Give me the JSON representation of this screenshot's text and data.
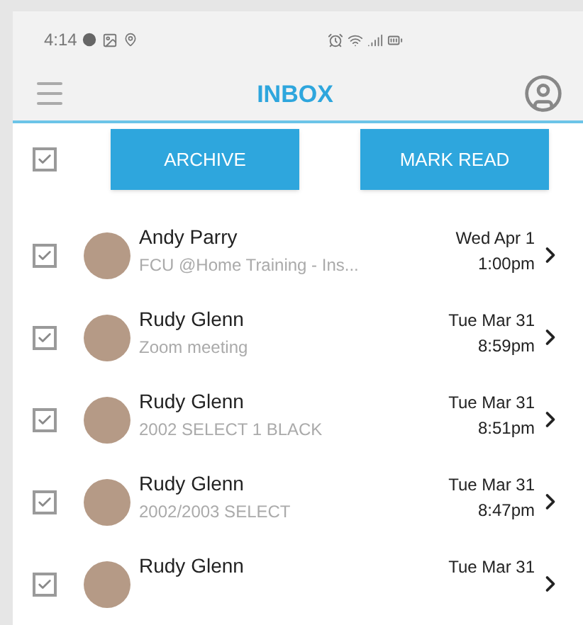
{
  "status_bar": {
    "time": "4:14"
  },
  "header": {
    "title": "INBOX"
  },
  "toolbar": {
    "select_all": {
      "checked": true
    },
    "buttons": [
      "ARCHIVE",
      "MARK READ"
    ]
  },
  "messages": [
    {
      "sender": "Andy Parry",
      "preview": "FCU @Home Training - Ins...",
      "date": "Wed Apr 1",
      "time": "1:00pm",
      "checked": true
    },
    {
      "sender": "Rudy Glenn",
      "preview": "Zoom meeting",
      "date": "Tue Mar 31",
      "time": "8:59pm",
      "checked": true
    },
    {
      "sender": "Rudy Glenn",
      "preview": "2002 SELECT 1 BLACK",
      "date": "Tue Mar 31",
      "time": "8:51pm",
      "checked": true
    },
    {
      "sender": "Rudy Glenn",
      "preview": "2002/2003 SELECT",
      "date": "Tue Mar 31",
      "time": "8:47pm",
      "checked": true
    },
    {
      "sender": "Rudy Glenn",
      "date": "Tue Mar 31",
      "checked": true
    }
  ]
}
